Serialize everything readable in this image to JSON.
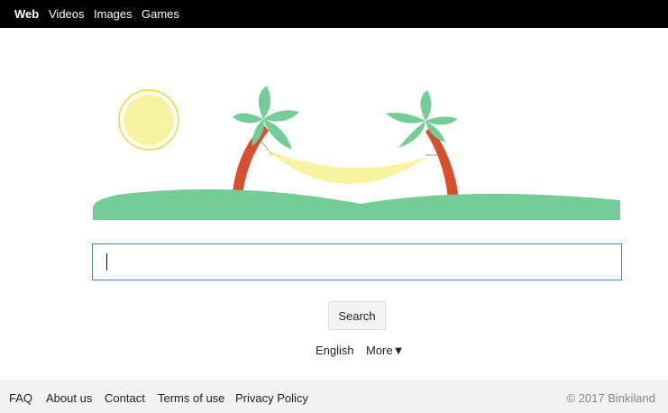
{
  "nav": {
    "web": "Web",
    "videos": "Videos",
    "images": "Images",
    "games": "Games"
  },
  "logo": {
    "icon": "beach-hammock-illustration",
    "colors": {
      "sun_fill": "#f8f3a0",
      "sun_ring": "#f0d840",
      "hammock": "#f8f3a0",
      "trunk": "#d4502e",
      "leaves": "#74cc96",
      "ground": "#74cc96"
    }
  },
  "search": {
    "value": "",
    "placeholder": "",
    "button_label": "Search",
    "border_color": "#4a7fd0"
  },
  "language": {
    "current": "English",
    "more": "More▼"
  },
  "footer": {
    "links": [
      "FAQ",
      "About us",
      "Contact",
      "Terms of use",
      "Privacy Policy"
    ],
    "copyright": "© 2017 Binkiland"
  }
}
